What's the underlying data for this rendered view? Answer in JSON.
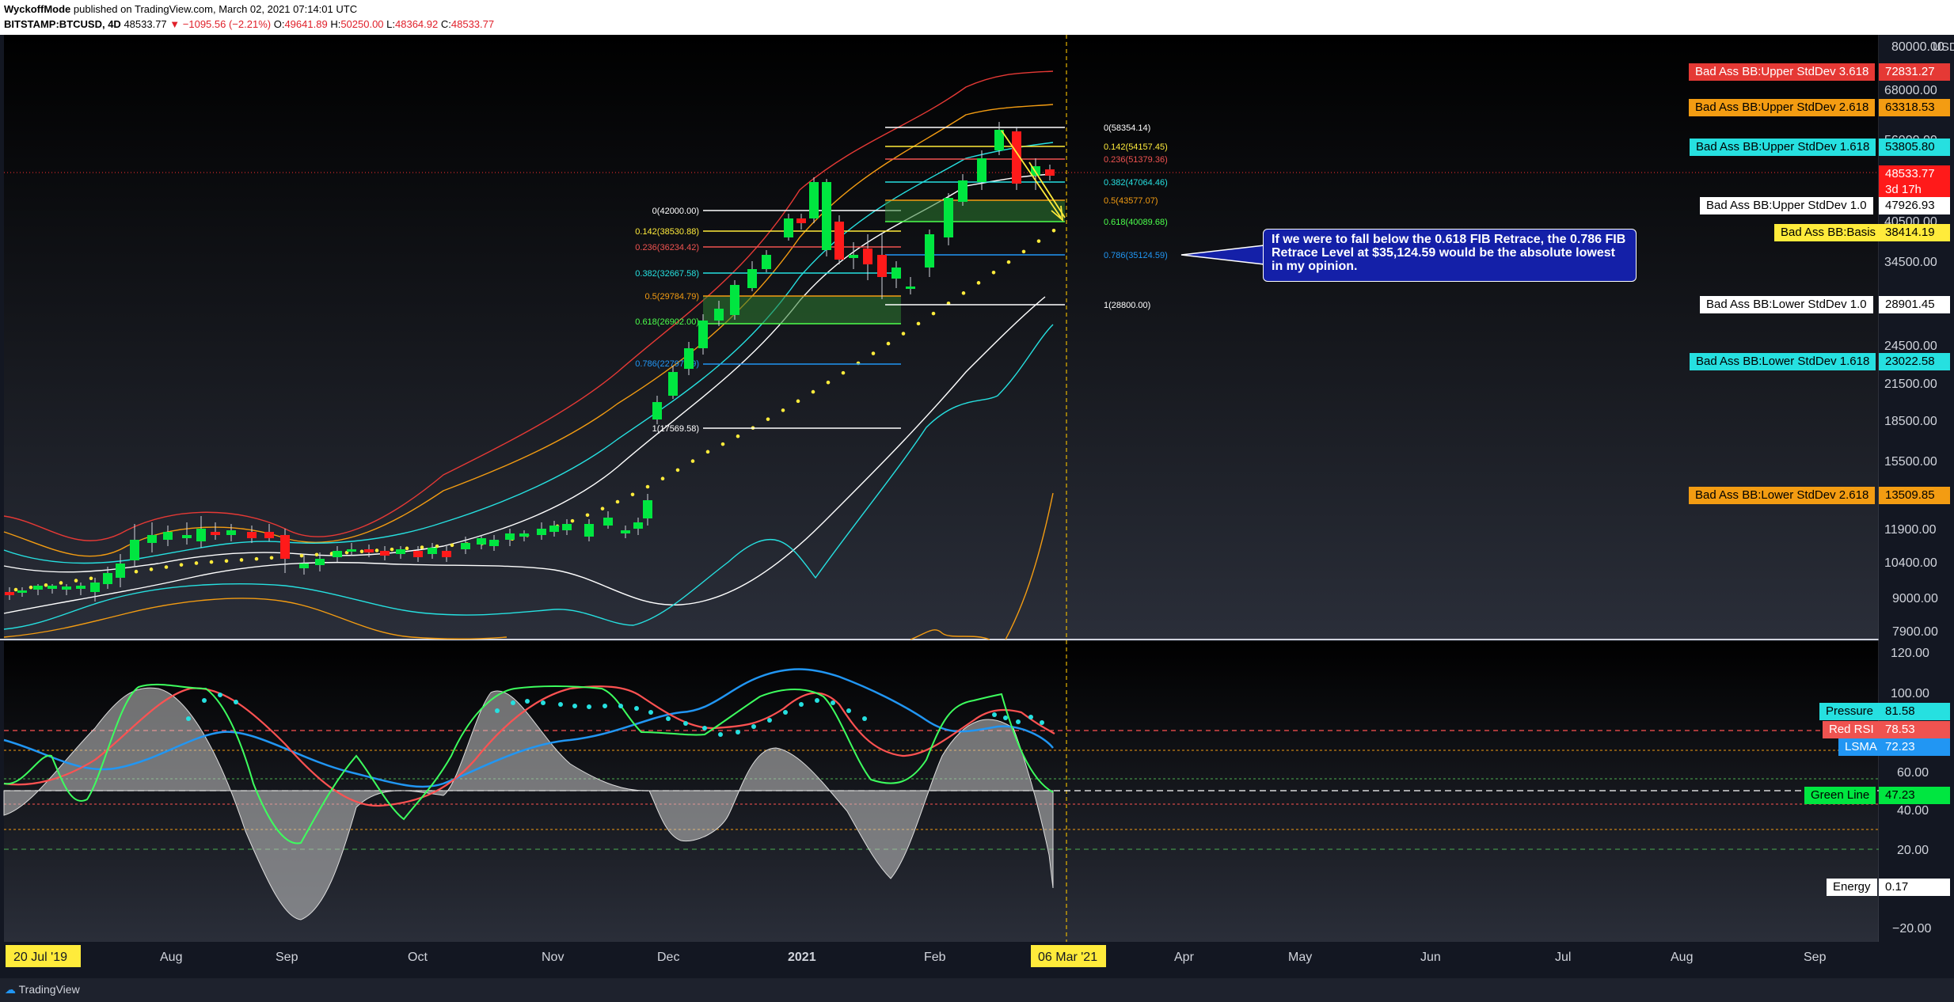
{
  "header": {
    "author": "WyckoffMode",
    "published": " published on TradingView.com, March 02, 2021 07:14:01 UTC",
    "symbol": "BITSTAMP:BTCUSD, 4D",
    "last": "48533.77",
    "change": "▼ −1095.56 (−2.21%)",
    "o_label": "O:",
    "o_val": "49641.89",
    "h_label": "H:",
    "h_val": "50250.00",
    "l_label": "L:",
    "l_val": "48364.92",
    "c_label": "C:",
    "c_val": "48533.77"
  },
  "colors": {
    "background": "#131722",
    "up": "#00e640",
    "down": "#ff1a1a",
    "white": "#ffffff",
    "yellow": "#ffeb3b",
    "cyan": "#26e0e0",
    "orange": "#f39c12",
    "red": "#e53935",
    "blue": "#2196f3"
  },
  "price_axis": {
    "currency": "USD",
    "ticks": [
      "80000.00",
      "68000.00",
      "56000.00",
      "40500.00",
      "34500.00",
      "24500.00",
      "21500.00",
      "18500.00",
      "15500.00",
      "11900.00",
      "10400.00",
      "9000.00",
      "7900.00"
    ],
    "labels": [
      {
        "text": "Bad Ass BB:Upper StdDev 3.618",
        "value": "72831.27",
        "color": "#e53935"
      },
      {
        "text": "Bad Ass BB:Upper StdDev 2.618",
        "value": "63318.53",
        "color": "#f39c12"
      },
      {
        "text": "Bad Ass BB:Upper StdDev 1.618",
        "value": "53805.80",
        "color": "#26e0e0"
      },
      {
        "text": "",
        "value": "48533.77",
        "sub": "3d 17h",
        "color": "#ff1a1a"
      },
      {
        "text": "Bad Ass BB:Upper StdDev 1.0",
        "value": "47926.93",
        "color": "#ffffff"
      },
      {
        "text": "Bad Ass BB:Basis",
        "value": "38414.19",
        "color": "#ffeb3b"
      },
      {
        "text": "Bad Ass BB:Lower StdDev 1.0",
        "value": "28901.45",
        "color": "#ffffff"
      },
      {
        "text": "Bad Ass BB:Lower StdDev 1.618",
        "value": "23022.58",
        "color": "#26e0e0"
      },
      {
        "text": "Bad Ass BB:Lower StdDev 2.618",
        "value": "13509.85",
        "color": "#f39c12"
      }
    ]
  },
  "fib_sets": [
    {
      "levels": [
        {
          "text": "0(42000.00)",
          "color": "#ffffff"
        },
        {
          "text": "0.142(38530.88)",
          "color": "#ffeb3b"
        },
        {
          "text": "0.236(36234.42)",
          "color": "#ef5350"
        },
        {
          "text": "0.382(32667.58)",
          "color": "#26e0e0"
        },
        {
          "text": "0.5(29784.79)",
          "color": "#f39c12"
        },
        {
          "text": "0.618(26902.00)",
          "color": "#4cff4c"
        },
        {
          "text": "0.786(22797.69)",
          "color": "#2196f3"
        },
        {
          "text": "1(17569.58)",
          "color": "#ffffff"
        }
      ]
    },
    {
      "levels": [
        {
          "text": "0(58354.14)",
          "color": "#ffffff"
        },
        {
          "text": "0.142(54157.45)",
          "color": "#ffeb3b"
        },
        {
          "text": "0.236(51379.36)",
          "color": "#ef5350"
        },
        {
          "text": "0.382(47064.46)",
          "color": "#26e0e0"
        },
        {
          "text": "0.5(43577.07)",
          "color": "#f39c12"
        },
        {
          "text": "0.618(40089.68)",
          "color": "#4cff4c"
        },
        {
          "text": "0.786(35124.59)",
          "color": "#2196f3"
        },
        {
          "text": "1(28800.00)",
          "color": "#ffffff"
        }
      ]
    }
  ],
  "annotation": "If we were to fall below the 0.618 FIB Retrace, the 0.786 FIB Retrace Level at $35,124.59 would be the absolute lowest in my opinion.",
  "oscillator": {
    "ticks": [
      "120.00",
      "100.00",
      "60.00",
      "40.00",
      "20.00",
      "−20.00"
    ],
    "labels": [
      {
        "text": "Pressure",
        "value": "81.58",
        "color": "#26e0e0"
      },
      {
        "text": "Red RSI",
        "value": "78.53",
        "color": "#ef5350"
      },
      {
        "text": "LSMA",
        "value": "72.23",
        "color": "#2196f3"
      },
      {
        "text": "Green Line",
        "value": "47.23",
        "color": "#00e640"
      },
      {
        "text": "Energy",
        "value": "0.17",
        "color": "#ffffff"
      }
    ]
  },
  "time_axis": {
    "highlight_start": "20 Jul '19",
    "highlight_cursor": "06 Mar '21",
    "months": [
      "Aug",
      "Sep",
      "Oct",
      "Nov",
      "Dec",
      "2021",
      "Feb",
      "Apr",
      "May",
      "Jun",
      "Jul",
      "Aug",
      "Sep"
    ]
  },
  "footer": {
    "brand": "TradingView"
  }
}
